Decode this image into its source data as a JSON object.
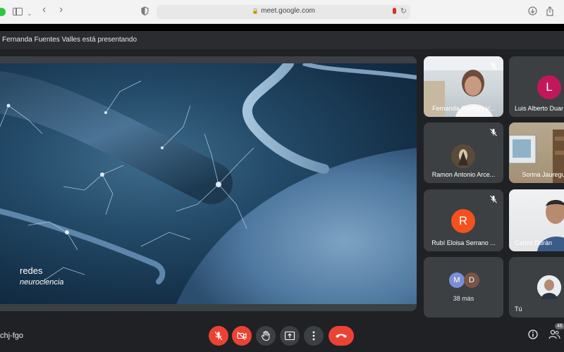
{
  "browser": {
    "url": "meet.google.com"
  },
  "header": {
    "presenting_text": "Fernanda Fuentes Valles está presentando"
  },
  "slide": {
    "caption_title": "redes",
    "caption_subtitle": "neurociencia"
  },
  "participants": [
    {
      "name": "Fernanda Fuentes V...",
      "muted": true,
      "type": "video"
    },
    {
      "name": "Luis Alberto Duar",
      "avatar_letter": "L",
      "avatar_color": "#c2185b",
      "type": "avatar"
    },
    {
      "name": "Ramon Antonio Arce...",
      "muted": true,
      "type": "photo"
    },
    {
      "name": "Sorina Jauregui",
      "type": "video"
    },
    {
      "name": "Rubí Eloisa Serrano ...",
      "avatar_letter": "R",
      "avatar_color": "#f4511e",
      "muted": true,
      "type": "avatar"
    },
    {
      "name": "Carlos Durán",
      "type": "video"
    },
    {
      "name": "Tú",
      "type": "video"
    }
  ],
  "more": {
    "avatars": [
      {
        "letter": "M",
        "color": "#7b8fd6"
      },
      {
        "letter": "D",
        "color": "#795548"
      }
    ],
    "label": "38 más"
  },
  "bottom": {
    "meeting_code": "chj-fgo",
    "people_count": "46"
  }
}
